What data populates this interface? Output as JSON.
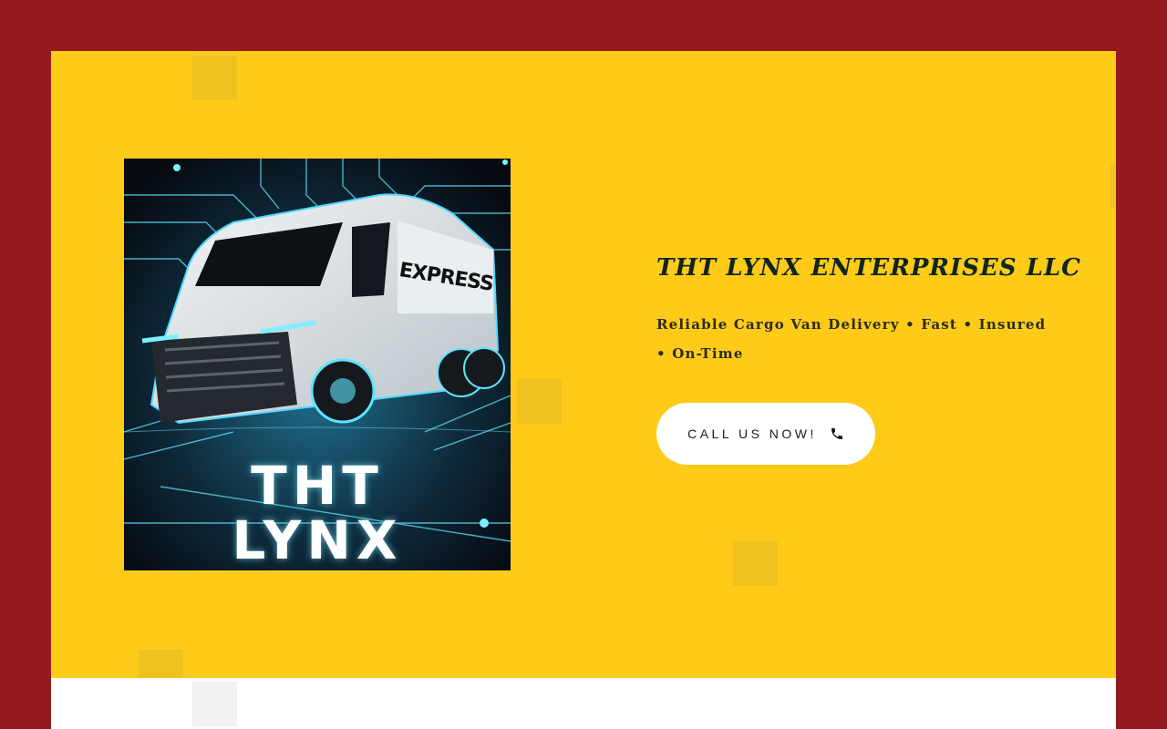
{
  "hero": {
    "background": "#fdcb18",
    "frame_color": "#941a1d",
    "logo": {
      "van_label": "EXPRESS",
      "text_line1": "THT",
      "text_line2": "LYNX"
    },
    "company_name": "THT LYNX ENTERPRISES LLC",
    "tagline": "Reliable Cargo Van Delivery • Fast • Insured • On-Time",
    "cta": {
      "label": "CALL US NOW!",
      "icon": "phone-icon"
    }
  }
}
